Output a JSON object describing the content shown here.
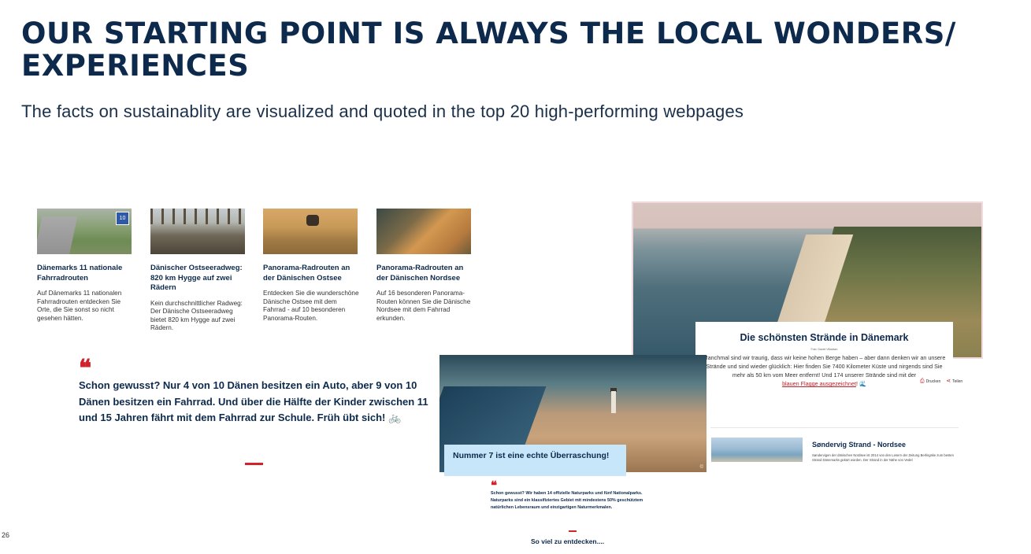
{
  "header": {
    "title": "OUR STARTING POINT IS ALWAYS THE LOCAL WONDERS/ EXPERIENCES",
    "subtitle": "The facts on sustainablity are visualized and quoted in the top 20 high-performing webpages"
  },
  "cards": [
    {
      "title": "Dänemarks 11 nationale Fahrradrouten",
      "text": "Auf Dänemarks 11 nationalen Fahrradrouten entdecken Sie Orte, die Sie sonst so nicht gesehen hätten.",
      "sign": "10"
    },
    {
      "title": "Dänischer Ostseeradweg: 820 km Hygge auf zwei Rädern",
      "text": "Kein durchschnittlicher Radweg: Der Dänische Ostseeradweg bietet 820 km Hygge auf zwei Rädern."
    },
    {
      "title": "Panorama-Radrouten an der Dänischen Ostsee",
      "text": "Entdecken Sie die wunderschöne Dänische Ostsee mit dem Fahrrad - auf 10 besonderen Panorama-Routen."
    },
    {
      "title": "Panorama-Radrouten an der Dänischen Nordsee",
      "text": "Auf 16 besonderen Panorama-Routen können Sie die Dänische Nordsee mit dem Fahrrad erkunden."
    }
  ],
  "quote1": {
    "mark": "❝",
    "text": "Schon gewusst? Nur 4 von 10 Dänen besitzen ein Auto, aber 9 von 10 Dänen besitzen ein Fahrrad. Und über die Hälfte der Kinder zwischen 11 und 15 Jahren fährt mit dem Fahrrad zur Schule. Früh übt sich! 🚲"
  },
  "beach_card": {
    "title": "Die schönsten Strände in Dänemark",
    "credit": "Foto: Daniel Villadsen",
    "text": "Manchmal sind wir traurig, dass wir keine hohen Berge haben – aber dann denken wir an unsere Strände und sind wieder glücklich: Hier finden Sie 7400 Kilometer Küste und nirgends sind Sie mehr als 50 km vom Meer entfernt! Und 174 unserer Strände sind mit der",
    "link": "blauen Flagge ausgezeichnet",
    "link_suffix": "! 🌊",
    "print_label": "Drucken",
    "share_label": "Teilen"
  },
  "strand": {
    "title": "Søndervig Strand - Nordsee",
    "text": "Søndervigen der dänischen Nordsee ist 2014 von den Lesern der Zeitung Berlingske zum besten Strand Dänemarks gekürt worden. Der Strand in der Nähe von Vedel"
  },
  "lighthouse": {
    "caption": "Nummer 7 ist eine echte Überraschung!",
    "copyright": "©"
  },
  "quote2": {
    "mark": "❝",
    "text": "Schon gewusst? Wir haben 14 offizielle Naturparks und fünf Nationalparks. Naturparks sind ein klassifiziertes Gebiet mit mindestens 50% geschütztem natürlichen Lebensraum und einzigartigen Naturmerkmalen."
  },
  "more_link": "So viel zu entdecken....",
  "page_number": "26",
  "colors": {
    "navy": "#0d2a4c",
    "accent_red": "#d1232a",
    "caption_blue": "#c8e6f9"
  }
}
